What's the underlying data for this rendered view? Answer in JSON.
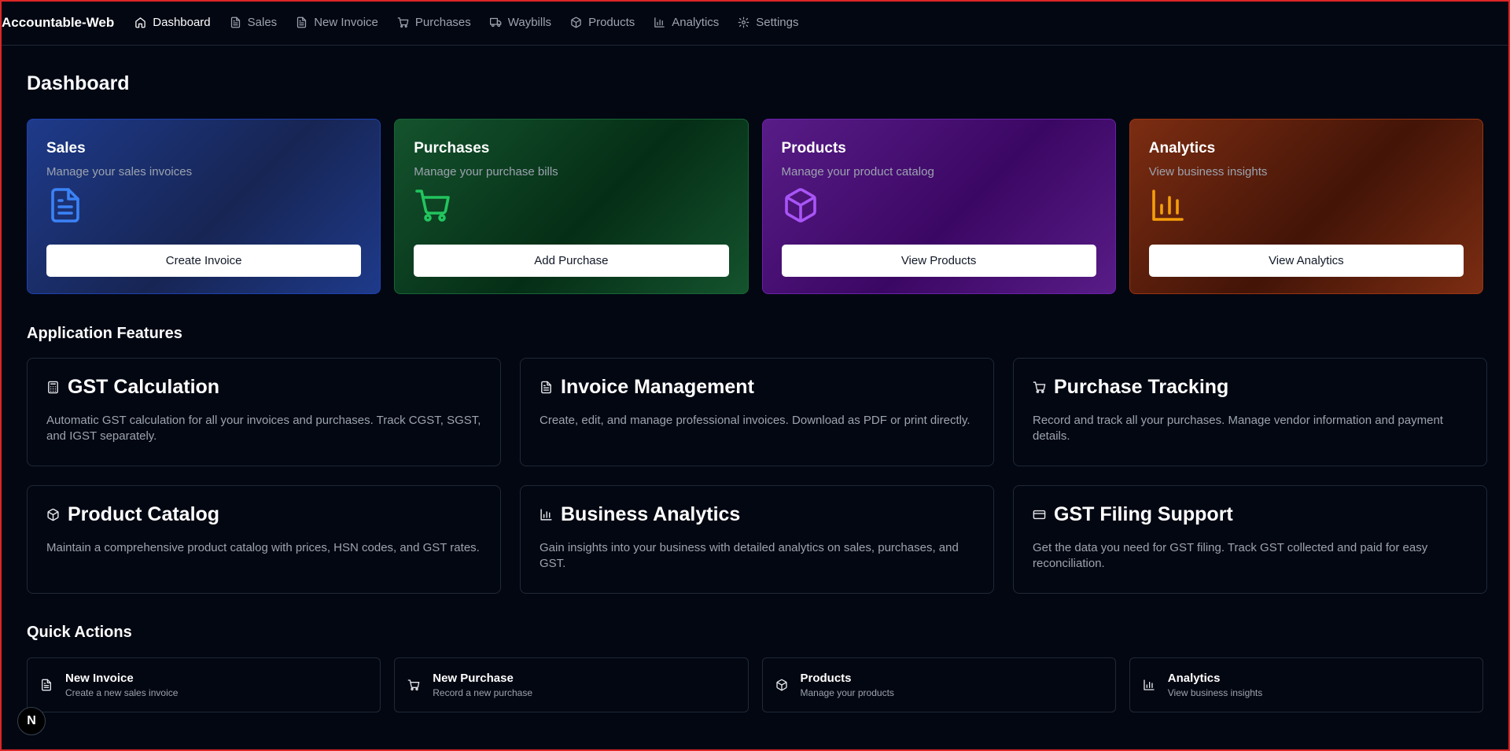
{
  "nav": {
    "brand": "Accountable-Web",
    "items": [
      {
        "label": "Dashboard",
        "icon": "home-icon"
      },
      {
        "label": "Sales",
        "icon": "file-icon"
      },
      {
        "label": "New Invoice",
        "icon": "file-icon"
      },
      {
        "label": "Purchases",
        "icon": "cart-icon"
      },
      {
        "label": "Waybills",
        "icon": "truck-icon"
      },
      {
        "label": "Products",
        "icon": "box-icon"
      },
      {
        "label": "Analytics",
        "icon": "bar-chart-icon"
      },
      {
        "label": "Settings",
        "icon": "gear-icon"
      }
    ]
  },
  "page": {
    "title": "Dashboard"
  },
  "cards": [
    {
      "title": "Sales",
      "desc": "Manage your sales invoices",
      "button": "Create Invoice",
      "icon": "file-icon",
      "color": "#3b82f6"
    },
    {
      "title": "Purchases",
      "desc": "Manage your purchase bills",
      "button": "Add Purchase",
      "icon": "cart-icon",
      "color": "#22c55e"
    },
    {
      "title": "Products",
      "desc": "Manage your product catalog",
      "button": "View Products",
      "icon": "box-icon",
      "color": "#a855f7"
    },
    {
      "title": "Analytics",
      "desc": "View business insights",
      "button": "View Analytics",
      "icon": "bar-chart-icon",
      "color": "#f59e0b"
    }
  ],
  "features_section": {
    "title": "Application Features"
  },
  "features": [
    {
      "title": "GST Calculation",
      "icon": "calculator-icon",
      "desc": "Automatic GST calculation for all your invoices and purchases. Track CGST, SGST, and IGST separately."
    },
    {
      "title": "Invoice Management",
      "icon": "file-icon",
      "desc": "Create, edit, and manage professional invoices. Download as PDF or print directly."
    },
    {
      "title": "Purchase Tracking",
      "icon": "cart-icon",
      "desc": "Record and track all your purchases. Manage vendor information and payment details."
    },
    {
      "title": "Product Catalog",
      "icon": "box-icon",
      "desc": "Maintain a comprehensive product catalog with prices, HSN codes, and GST rates."
    },
    {
      "title": "Business Analytics",
      "icon": "bar-chart-icon",
      "desc": "Gain insights into your business with detailed analytics on sales, purchases, and GST."
    },
    {
      "title": "GST Filing Support",
      "icon": "credit-card-icon",
      "desc": "Get the data you need for GST filing. Track GST collected and paid for easy reconciliation."
    }
  ],
  "quick_section": {
    "title": "Quick Actions"
  },
  "quick_actions": [
    {
      "title": "New Invoice",
      "sub": "Create a new sales invoice",
      "icon": "file-icon"
    },
    {
      "title": "New Purchase",
      "sub": "Record a new purchase",
      "icon": "cart-icon"
    },
    {
      "title": "Products",
      "sub": "Manage your products",
      "icon": "box-icon"
    },
    {
      "title": "Analytics",
      "sub": "View business insights",
      "icon": "bar-chart-icon"
    }
  ],
  "badge": {
    "label": "N"
  }
}
